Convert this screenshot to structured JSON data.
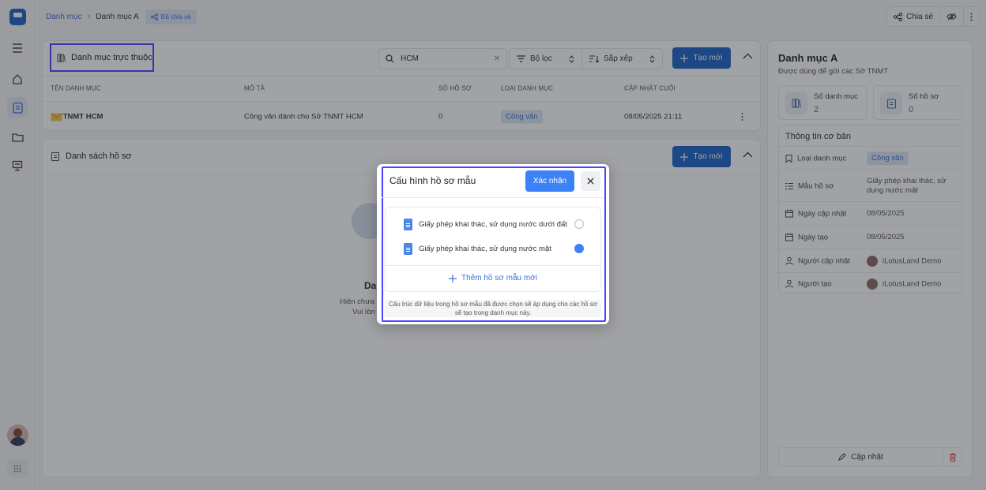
{
  "breadcrumb": {
    "root": "Danh mục",
    "current": "Danh mục A",
    "shared_tag": "Đã chia sẻ"
  },
  "top_actions": {
    "share_label": "Chia sẻ"
  },
  "sub_panel": {
    "title": "Danh mục trực thuộc",
    "search_value": "HCM",
    "filter_label": "Bộ lọc",
    "sort_label": "Sắp xếp",
    "create_label": "Tạo mới",
    "columns": [
      "TÊN DANH MỤC",
      "MÔ TẢ",
      "SỐ HỒ SƠ",
      "LOẠI DANH MỤC",
      "CẬP NHẬT CUỐI"
    ],
    "rows": [
      {
        "name": "Sở TNMT HCM",
        "description": "Công văn dành cho Sở TNMT HCM",
        "count": "0",
        "type": "Công văn",
        "updated": "08/05/2025 21:11"
      }
    ]
  },
  "records_panel": {
    "title": "Danh sách hồ sơ",
    "create_label": "Tạo mới",
    "empty_title": "Da",
    "empty_line1": "Hiện chưa",
    "empty_line2": "Vui lòn"
  },
  "detail": {
    "title": "Danh mục A",
    "subtitle": "Được dùng để gửi các Sở TNMT",
    "stats": [
      {
        "label": "Số danh mục",
        "value": "2"
      },
      {
        "label": "Số hồ sơ",
        "value": "0"
      }
    ],
    "info_title": "Thông tin cơ bản",
    "info": {
      "type_label": "Loại danh mục",
      "type_value": "Công văn",
      "template_label": "Mẫu hồ sơ",
      "template_value": "Giấy phép khai thác, sử dụng nước mặt",
      "updated_label": "Ngày cập nhật",
      "updated_value": "08/05/2025",
      "created_label": "Ngày tạo",
      "created_value": "08/05/2025",
      "updater_label": "Người cập nhật",
      "updater_value": "iLotusLand Demo",
      "creator_label": "Người tạo",
      "creator_value": "iLotusLand Demo"
    },
    "update_label": "Cập nhật"
  },
  "modal": {
    "title": "Cấu hình hồ sơ mẫu",
    "confirm_label": "Xác nhận",
    "options": [
      {
        "label": "Giấy phép khai thác, sử dụng nước dưới đất",
        "selected": false
      },
      {
        "label": "Giấy phép khai thác, sử dụng nước mặt",
        "selected": true
      }
    ],
    "add_label": "Thêm hồ sơ mẫu mới",
    "note": "Cấu trúc dữ liệu trong hồ sơ mẫu đã được chọn sẽ áp dụng cho các hồ sơ sẽ tạo trong danh mục này."
  },
  "colors": {
    "primary": "#1e63c9",
    "accent": "#3b82f6",
    "highlight": "#4b43ff",
    "badge_bg": "#dde7f7"
  }
}
